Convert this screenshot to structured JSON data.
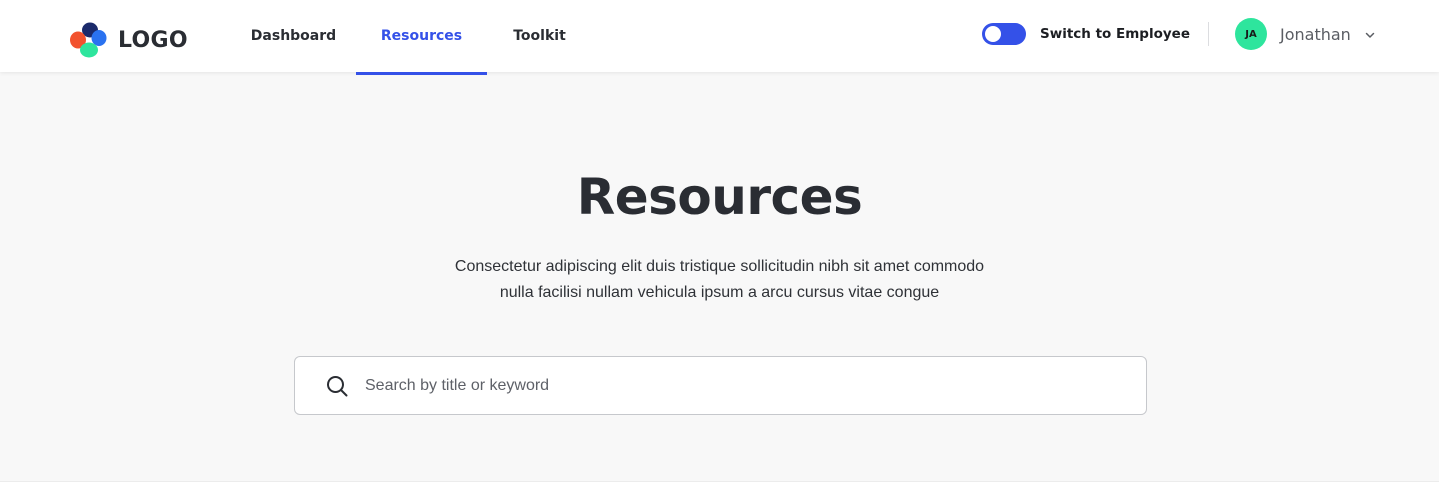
{
  "brand": {
    "logo_text": "LOGO"
  },
  "nav": {
    "items": [
      {
        "label": "Dashboard",
        "active": false
      },
      {
        "label": "Resources",
        "active": true
      },
      {
        "label": "Toolkit",
        "active": false
      }
    ]
  },
  "header_right": {
    "switch_label": "Switch to Employee",
    "switch_on": true,
    "user_initials": "JA",
    "user_name": "Jonathan"
  },
  "main": {
    "title": "Resources",
    "description_line1": "Consectetur adipiscing elit duis tristique sollicitudin nibh sit amet commodo",
    "description_line2": "nulla facilisi nullam vehicula ipsum a arcu cursus vitae congue"
  },
  "search": {
    "placeholder": "Search by title or keyword",
    "value": ""
  },
  "colors": {
    "accent": "#3451e8",
    "avatar_bg": "#2ee59d",
    "text": "#2a2d33",
    "page_bg": "#f8f8f8"
  }
}
